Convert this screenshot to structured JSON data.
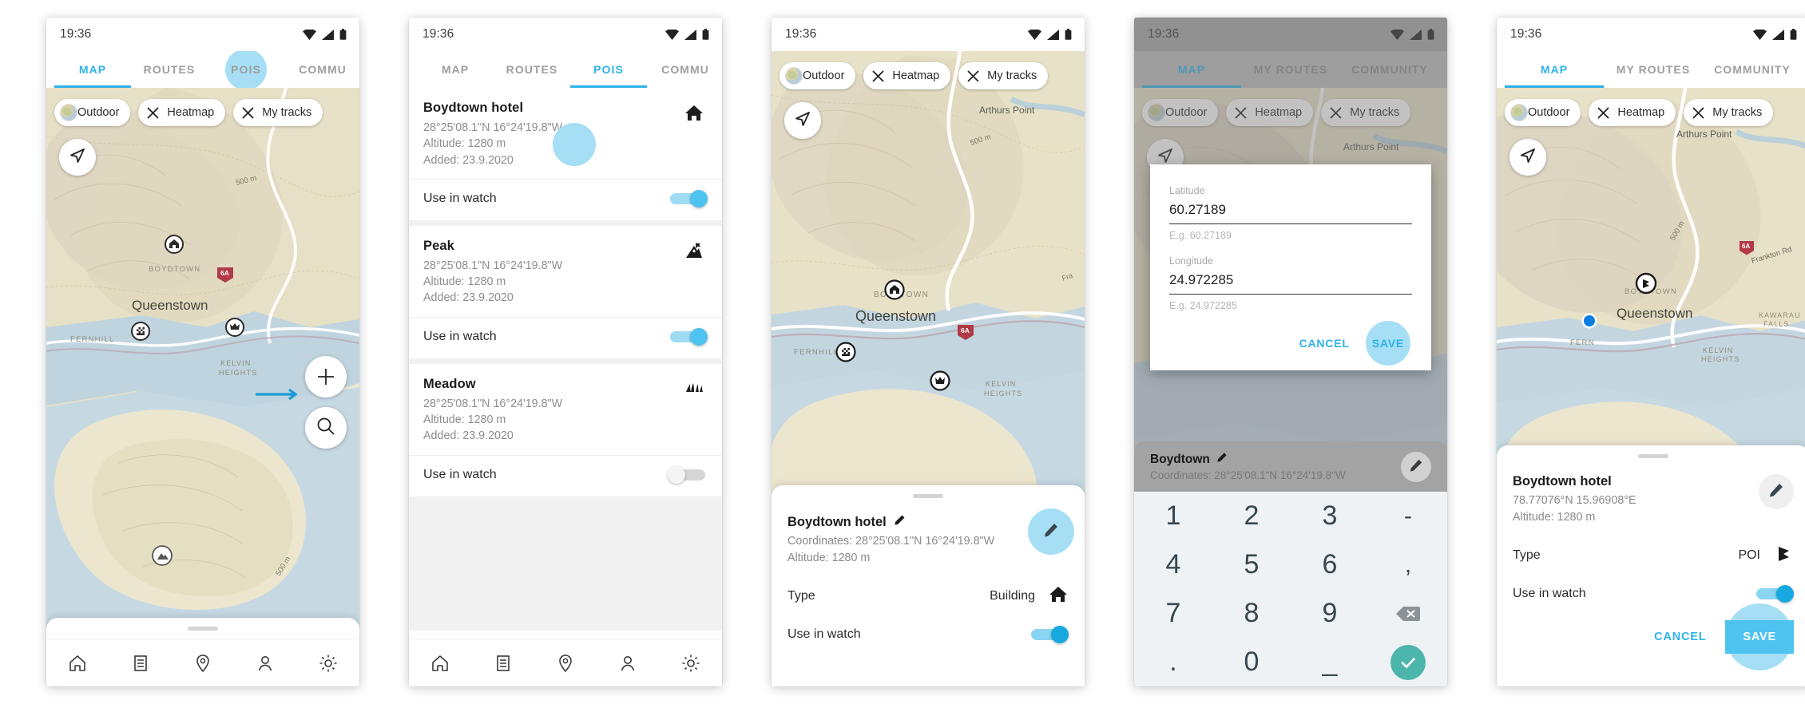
{
  "status_bar": {
    "time": "19:36",
    "icons": [
      "wifi-icon",
      "signal-icon",
      "battery-icon"
    ]
  },
  "colors": {
    "accent": "#2cb2ea",
    "accent_light": "#a6dff5",
    "toggle_on": "#4ec3ef",
    "ok_green": "#4db6ac"
  },
  "map_chips": [
    {
      "label": "Outdoor",
      "icon": "globe-icon"
    },
    {
      "label": "Heatmap",
      "icon": "close-x-icon"
    },
    {
      "label": "My tracks",
      "icon": "close-x-icon"
    }
  ],
  "map_labels": {
    "arthurs_point": "Arthurs Point",
    "boydtown": "BOYDTOWN",
    "queenstown": "Queenstown",
    "fernhill": "FERNHILL",
    "kelvin_heights": "KELVIN HEIGHTS",
    "kawarau_falls": "KAWARAU FALLS",
    "frankton_rd": "Frankton Rd",
    "contour": "500 m",
    "highway_shield": "6A"
  },
  "bottom_nav": [
    {
      "name": "home-icon"
    },
    {
      "name": "list-icon"
    },
    {
      "name": "pin-icon"
    },
    {
      "name": "person-icon"
    },
    {
      "name": "gear-icon"
    }
  ],
  "panel1": {
    "tabs": [
      {
        "label": "MAP",
        "active": true
      },
      {
        "label": "ROUTES",
        "active": false
      },
      {
        "label": "POIS",
        "active": false,
        "highlighted": true
      },
      {
        "label": "COMMU",
        "active": false
      }
    ],
    "zoom_in": "+",
    "search_icon": "search-icon",
    "locate_icon": "navigation-arrow-icon"
  },
  "panel2": {
    "tabs": [
      {
        "label": "MAP",
        "active": false
      },
      {
        "label": "ROUTES",
        "active": false
      },
      {
        "label": "POIS",
        "active": true
      },
      {
        "label": "COMMU",
        "active": false
      }
    ],
    "toggle_label": "Use in watch",
    "items": [
      {
        "title": "Boydtown hotel",
        "coordinates": "28°25'08.1\"N 16°24'19.8\"W",
        "altitude": "Altitude: 1280 m",
        "added": "Added: 23.9.2020",
        "icon": "house-icon",
        "toggle": "on",
        "tap_blob": true
      },
      {
        "title": "Peak",
        "coordinates": "28°25'08.1\"N 16°24'19.8\"W",
        "altitude": "Altitude: 1280 m",
        "added": "Added: 23.9.2020",
        "icon": "mountain-flag-icon",
        "toggle": "on",
        "tap_blob": false
      },
      {
        "title": "Meadow",
        "coordinates": "28°25'08.1\"N 16°24'19.8\"W",
        "altitude": "Altitude: 1280 m",
        "added": "Added: 23.9.2020",
        "icon": "grass-icon",
        "toggle": "off",
        "tap_blob": false
      }
    ]
  },
  "panel3": {
    "detail": {
      "title": "Boydtown hotel",
      "edit_icon": "pencil-icon",
      "coordinates": "Coordinates: 28°25'08.1\"N 16°24'19.8\"W",
      "altitude": "Altitude: 1280 m",
      "type_label": "Type",
      "type_value": "Building",
      "type_icon": "house-icon",
      "toggle_label": "Use in watch",
      "toggle": "on",
      "fab_icon": "pencil-icon"
    }
  },
  "panel4": {
    "tabs": [
      {
        "label": "MAP",
        "active": true
      },
      {
        "label": "MY ROUTES",
        "active": false
      },
      {
        "label": "COMMUNITY",
        "active": false
      }
    ],
    "dialog": {
      "latitude_label": "Latitude",
      "latitude_value": "60.27189",
      "latitude_hint": "E.g. 60.27189",
      "longitude_label": "Longitude",
      "longitude_value": "24.972285",
      "longitude_hint": "E.g. 24.972285",
      "cancel": "CANCEL",
      "save": "SAVE"
    },
    "mini_detail": {
      "title": "Boydtown",
      "edit_icon": "pencil-icon",
      "coordinates": "Coordinates: 28°25'08.1\"N 16°24'19.8\"W"
    },
    "keypad": [
      "1",
      "2",
      "3",
      "-",
      "4",
      "5",
      "6",
      ",",
      "7",
      "8",
      "9",
      "backspace-icon",
      ".",
      "0",
      "_",
      "check-icon"
    ]
  },
  "panel5": {
    "tabs": [
      {
        "label": "MAP",
        "active": true
      },
      {
        "label": "MY ROUTES",
        "active": false
      },
      {
        "label": "COMMUNITY",
        "active": false
      }
    ],
    "detail": {
      "title": "Boydtown hotel",
      "coordinates": "78.77076°N 15.96908°E",
      "altitude": "Altitude: 1280 m",
      "type_label": "Type",
      "type_value": "POI",
      "type_icon": "flag-icon",
      "toggle_label": "Use in watch",
      "toggle": "on",
      "fab_icon": "pencil-icon",
      "cancel": "CANCEL",
      "save": "SAVE"
    }
  }
}
